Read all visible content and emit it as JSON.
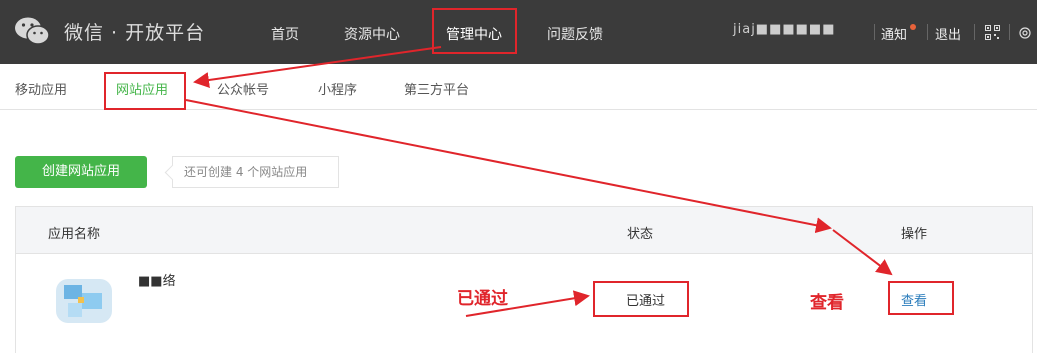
{
  "topbar": {
    "logo_text": "微信 · 开放平台",
    "nav": [
      "首页",
      "资源中心",
      "管理中心",
      "问题反馈"
    ],
    "user_name": "jiaj■■■■■■",
    "notify_label": "通知",
    "logout_label": "退出"
  },
  "subnav": {
    "items": [
      "移动应用",
      "网站应用",
      "公众帐号",
      "小程序",
      "第三方平台"
    ],
    "active_index": 1
  },
  "toolbar": {
    "create_button": "创建网站应用",
    "quota_text": "还可创建 4 个网站应用"
  },
  "table": {
    "headers": [
      "应用名称",
      "状态",
      "操作"
    ],
    "rows": [
      {
        "name": "■■络",
        "status": "已通过",
        "action": "查看"
      }
    ]
  },
  "annotations": {
    "status_note": "已通过",
    "action_note": "查看"
  },
  "colors": {
    "accent_green": "#44b549",
    "annotation_red": "#e0252b",
    "link_blue": "#2b7dbc",
    "topbar_bg": "#3b3b3b"
  }
}
